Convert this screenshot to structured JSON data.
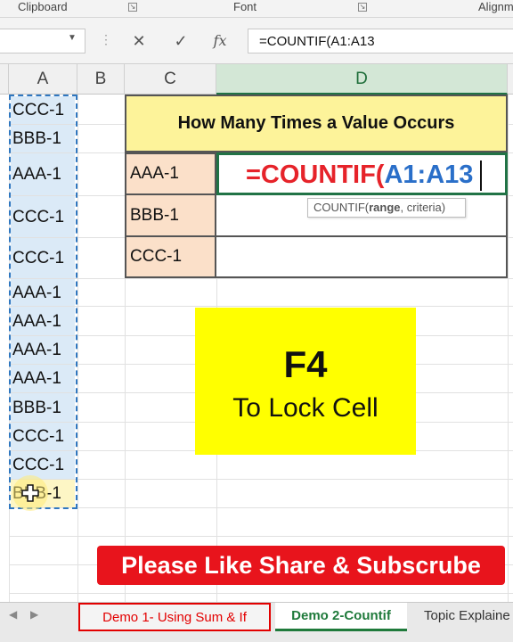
{
  "ribbon": {
    "groups": [
      "Clipboard",
      "Font",
      "Alignm"
    ]
  },
  "formula_bar": {
    "cancel_icon": "✕",
    "enter_icon": "✓",
    "fx_label": "fx",
    "formula": "=COUNTIF(A1:A13"
  },
  "columns": [
    "A",
    "B",
    "C",
    "D"
  ],
  "column_a": [
    "CCC-1",
    "BBB-1",
    "AAA-1",
    "CCC-1",
    "CCC-1",
    "AAA-1",
    "AAA-1",
    "AAA-1",
    "AAA-1",
    "BBB-1",
    "CCC-1",
    "CCC-1",
    "BBB-1"
  ],
  "table": {
    "title": "How Many Times a Value Occurs",
    "labels": [
      "AAA-1",
      "BBB-1",
      "CCC-1"
    ],
    "active_formula_fn": "=COUNTIF(",
    "active_formula_range": "A1:A13",
    "tooltip_fn": "COUNTIF(",
    "tooltip_arg1": "range",
    "tooltip_rest": ", criteria)"
  },
  "callout": {
    "key": "F4",
    "text": "To Lock Cell"
  },
  "banner": "Please Like Share & Subscrube",
  "sheet_tabs": [
    "Demo 1- Using Sum & If",
    "Demo 2-Countif",
    "Topic Explaine"
  ],
  "colors": {
    "accent": "#217346",
    "formula_fn": "#e6232a",
    "formula_range": "#2a6fc9",
    "callout_bg": "#ffff00",
    "banner_bg": "#e8141c"
  }
}
